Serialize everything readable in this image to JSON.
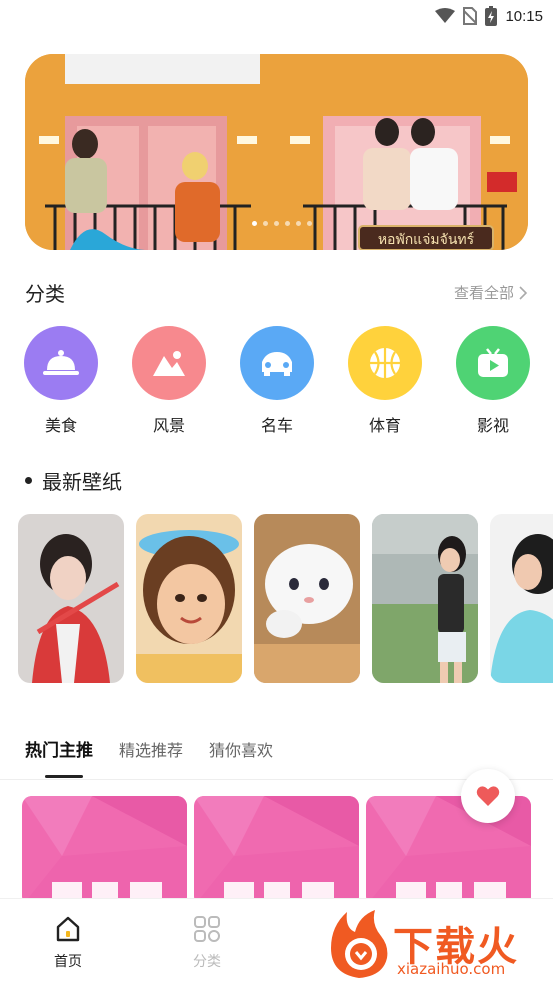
{
  "status_bar": {
    "time": "10:15"
  },
  "banner": {
    "sign_text": "หอพักแจ่มจันทร์",
    "slides": 6,
    "active_slide": 1
  },
  "categories_section": {
    "title": "分类",
    "see_all": "查看全部",
    "items": [
      {
        "label": "美食",
        "icon": "food-cloche-icon",
        "color": "#9b7cf2"
      },
      {
        "label": "风景",
        "icon": "mountain-icon",
        "color": "#f7898e"
      },
      {
        "label": "名车",
        "icon": "car-icon",
        "color": "#5aa9f5"
      },
      {
        "label": "体育",
        "icon": "basketball-icon",
        "color": "#ffd23c"
      },
      {
        "label": "影视",
        "icon": "tv-play-icon",
        "color": "#4fd374"
      }
    ]
  },
  "newest_section": {
    "title": "最新壁纸"
  },
  "tabs": [
    {
      "label": "热门主推",
      "active": true
    },
    {
      "label": "精选推荐",
      "active": false
    },
    {
      "label": "猜你喜欢",
      "active": false
    }
  ],
  "bottom_nav": [
    {
      "label": "首页",
      "icon": "home-icon",
      "active": true
    },
    {
      "label": "分类",
      "icon": "grid-icon",
      "active": false
    }
  ],
  "watermark": {
    "text": "下载火",
    "url": "xiazaihuo.com"
  },
  "colors": {
    "accent": "#222222",
    "heart": "#ee5a5a",
    "card_pink": "#f06ab0",
    "watermark": "#f05a22"
  }
}
